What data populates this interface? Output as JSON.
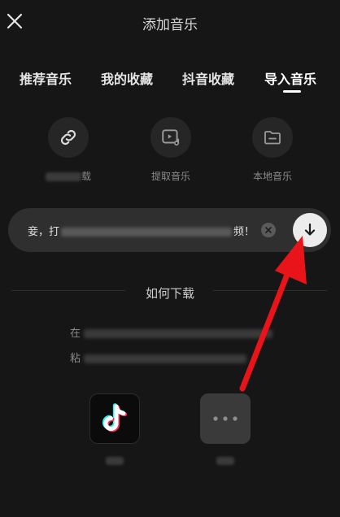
{
  "header": {
    "title": "添加音乐"
  },
  "tabs": [
    {
      "label": "推荐音乐",
      "active": false
    },
    {
      "label": "我的收藏",
      "active": false
    },
    {
      "label": "抖音收藏",
      "active": false
    },
    {
      "label": "导入音乐",
      "active": true
    }
  ],
  "sources": [
    {
      "icon": "link-icon",
      "label_suffix": "载"
    },
    {
      "icon": "video-music-icon",
      "label": "提取音乐"
    },
    {
      "icon": "folder-icon",
      "label": "本地音乐"
    }
  ],
  "link_input": {
    "prefix": "妾，打",
    "suffix": "频！"
  },
  "how_to": {
    "title": "如何下载",
    "line1_prefix": "在",
    "line2_prefix": "粘"
  },
  "apps": [
    {
      "icon": "tiktok-icon"
    },
    {
      "icon": "more-icon"
    }
  ],
  "colors": {
    "accent_arrow": "#e8141a",
    "background": "#161616"
  }
}
